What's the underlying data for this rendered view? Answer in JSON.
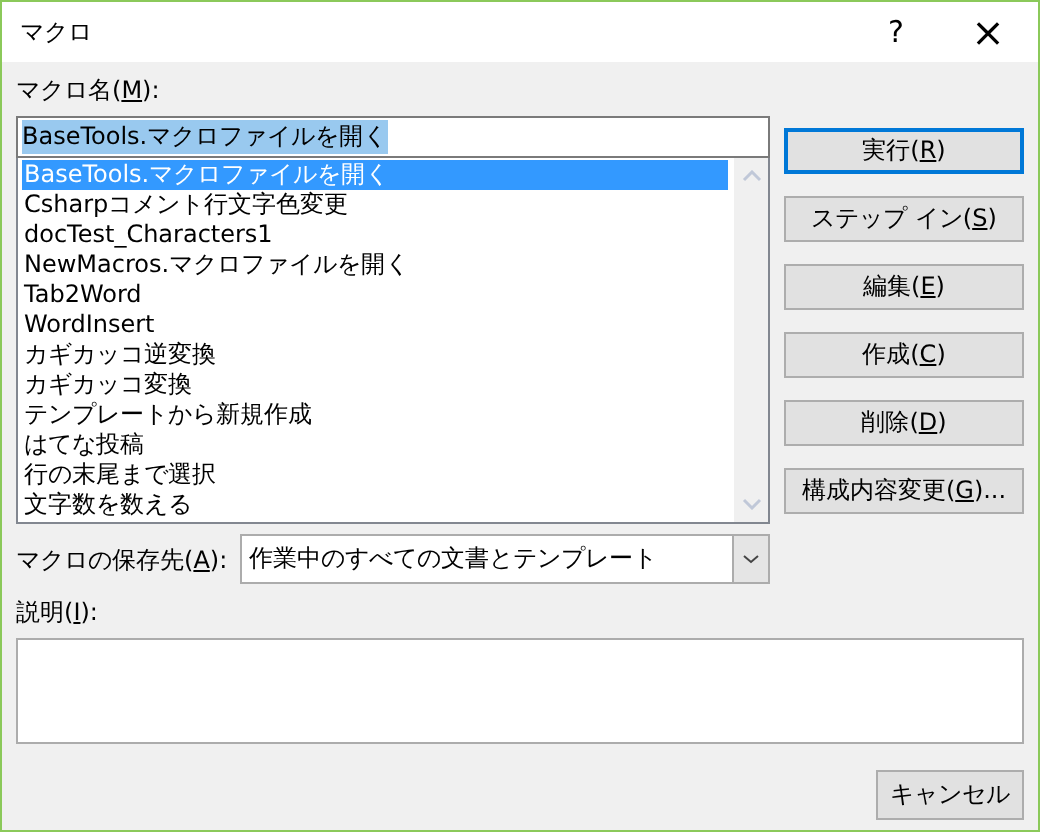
{
  "window": {
    "title": "マクロ",
    "help": "?",
    "close": "×"
  },
  "macro_name": {
    "label": {
      "pre": "マクロ名(",
      "key": "M",
      "post": "):"
    },
    "value": "BaseTools.マクロファイルを開く",
    "value_selected": true
  },
  "macro_list": [
    {
      "name": "BaseTools.マクロファイルを開く",
      "selected": true
    },
    {
      "name": "Csharpコメント行文字色変更",
      "selected": false
    },
    {
      "name": "docTest_Characters1",
      "selected": false
    },
    {
      "name": "NewMacros.マクロファイルを開く",
      "selected": false
    },
    {
      "name": "Tab2Word",
      "selected": false
    },
    {
      "name": "WordInsert",
      "selected": false
    },
    {
      "name": "カギカッコ逆変換",
      "selected": false
    },
    {
      "name": "カギカッコ変換",
      "selected": false
    },
    {
      "name": "テンプレートから新規作成",
      "selected": false
    },
    {
      "name": "はてな投稿",
      "selected": false
    },
    {
      "name": "行の末尾まで選択",
      "selected": false
    },
    {
      "name": "文字数を数える",
      "selected": false
    }
  ],
  "buttons": [
    {
      "pre": "実行(",
      "key": "R",
      "post": ")",
      "default": true
    },
    {
      "pre": "ステップ イン(",
      "key": "S",
      "post": ")",
      "default": false
    },
    {
      "pre": "編集(",
      "key": "E",
      "post": ")",
      "default": false
    },
    {
      "pre": "作成(",
      "key": "C",
      "post": ")",
      "default": false
    },
    {
      "pre": "削除(",
      "key": "D",
      "post": ")",
      "default": false
    },
    {
      "pre": "構成内容変更(",
      "key": "G",
      "post": ")...",
      "default": false
    }
  ],
  "location": {
    "label": {
      "pre": "マクロの保存先(",
      "key": "A",
      "post": "):"
    },
    "value": "作業中のすべての文書とテンプレート"
  },
  "description": {
    "label": {
      "pre": "説明(",
      "key": "I",
      "post": "):"
    }
  },
  "cancel_button": "キャンセル"
}
